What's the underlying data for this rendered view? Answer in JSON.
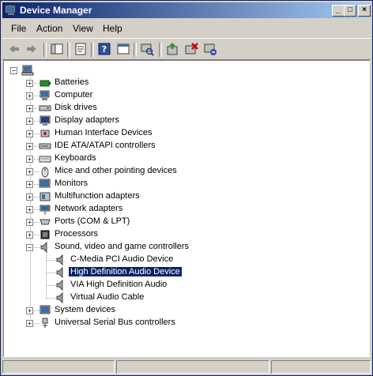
{
  "window": {
    "title": "Device Manager"
  },
  "menu": [
    {
      "label": "File"
    },
    {
      "label": "Action"
    },
    {
      "label": "View"
    },
    {
      "label": "Help"
    }
  ],
  "toolbar_icons": [
    "back-icon",
    "forward-icon",
    "console-tree-icon",
    "properties-icon",
    "help-icon",
    "view-icon",
    "scan-hardware-icon",
    "update-driver-icon",
    "uninstall-icon",
    "disable-icon"
  ],
  "tree": {
    "root_label": "",
    "categories": [
      {
        "label": "Batteries",
        "icon": "battery-icon"
      },
      {
        "label": "Computer",
        "icon": "computer-icon"
      },
      {
        "label": "Disk drives",
        "icon": "disk-drive-icon"
      },
      {
        "label": "Display adapters",
        "icon": "display-adapter-icon"
      },
      {
        "label": "Human Interface Devices",
        "icon": "hid-icon"
      },
      {
        "label": "IDE ATA/ATAPI controllers",
        "icon": "ide-controller-icon"
      },
      {
        "label": "Keyboards",
        "icon": "keyboard-icon"
      },
      {
        "label": "Mice and other pointing devices",
        "icon": "mouse-icon"
      },
      {
        "label": "Monitors",
        "icon": "monitor-icon"
      },
      {
        "label": "Multifunction adapters",
        "icon": "multifunction-icon"
      },
      {
        "label": "Network adapters",
        "icon": "network-icon"
      },
      {
        "label": "Ports (COM & LPT)",
        "icon": "port-icon"
      },
      {
        "label": "Processors",
        "icon": "processor-icon"
      },
      {
        "label": "Sound, video and game controllers",
        "icon": "speaker-icon"
      },
      {
        "label": "System devices",
        "icon": "system-icon"
      },
      {
        "label": "Universal Serial Bus controllers",
        "icon": "usb-icon"
      }
    ],
    "sound_children": [
      {
        "label": "C-Media PCI Audio Device"
      },
      {
        "label": "High Definition Audio Device",
        "selected": true
      },
      {
        "label": "VIA High Definition Audio"
      },
      {
        "label": "Virtual Audio Cable"
      }
    ]
  },
  "status": {
    "pane1": "",
    "pane2": "",
    "pane3": ""
  }
}
